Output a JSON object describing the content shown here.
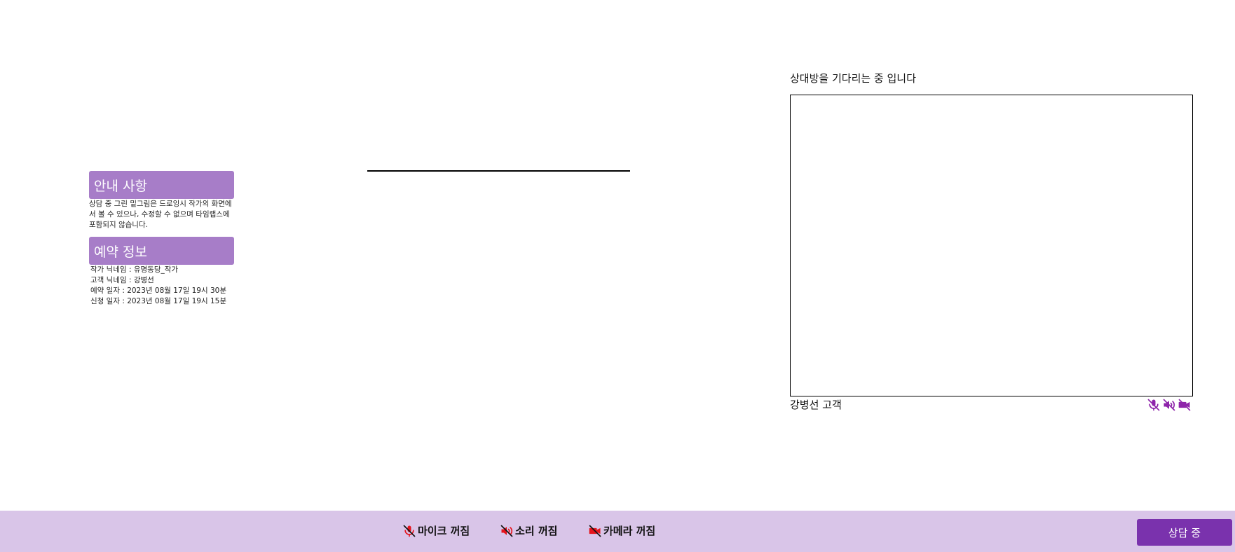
{
  "info": {
    "notice_title": "안내 사항",
    "notice_text": "상담 중 그린 밑그림은 드로잉시 작가의 화면에서 볼 수 있으나, 수정할 수 없으며 타임랩스에 포함되지 않습니다.",
    "reserve_title": "예약 정보",
    "reserve_lines": [
      "작가 닉네임 : 유명동당_작가",
      "고객 닉네임 : 강병선",
      "예약 일자 : 2023년 08월 17일 19시 30분",
      "신청 일자 : 2023년 08월 17일 19시 15분"
    ]
  },
  "video": {
    "waiting_text": "상대방을 기다리는 중 입니다",
    "peer_name": "강병선 고객",
    "peer_icons": [
      "mic-off-icon",
      "speaker-off-icon",
      "camera-off-icon"
    ]
  },
  "controls": {
    "mic_label": "마이크 꺼짐",
    "sound_label": "소리 꺼짐",
    "camera_label": "카메라 꺼짐",
    "status_button": "상담 중"
  },
  "colors": {
    "accent_purple": "#a77dc8",
    "icon_purple": "#8e24aa",
    "off_red": "#e5141c",
    "bar_bg": "#d9c5e8",
    "status_button": "#7a32ad"
  }
}
